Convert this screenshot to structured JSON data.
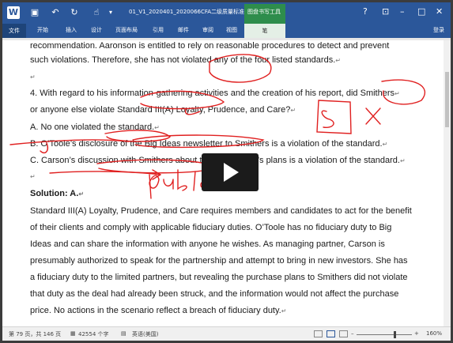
{
  "window": {
    "title": "01_V1_2020401_2020066CFA二级质量标准...",
    "contextual_tab": "图盘书写工具"
  },
  "ribbon": {
    "tabs": [
      "文件",
      "开始",
      "插入",
      "设计",
      "页面布局",
      "引用",
      "邮件",
      "审阅",
      "视图",
      "笔"
    ],
    "login": "登录"
  },
  "document": {
    "lines": [
      "recommendation. Aaronson is entitled to rely on reasonable procedures to detect and prevent",
      "such violations. Therefore, she has not violated any of the four listed standards.",
      "4.    With regard to his information-gathering activities and the creation of his report, did Smithers",
      "      or anyone else violate Standard III(A) Loyalty, Prudence, and Care?",
      "A.    No one violated the standard.",
      "B.    O’Toole’s disclosure of the Big Ideas newsletter to Smithers is a violation of the standard.",
      "C.    Carson’s discussion with Smithers about the partnership’s plans is a violation of the standard.",
      "Solution: A.",
      "Standard III(A) Loyalty, Prudence, and Care requires members and candidates to act for the benefit",
      "of their clients and comply with applicable fiduciary duties. O’Toole has no fiduciary duty to Big",
      "Ideas and can share the information with anyone he wishes. As managing partner, Carson is",
      "presumably authorized to speak for the partnership and attempt to bring in new investors. She has",
      "a fiduciary duty to the limited partners, but revealing the purchase plans to Smithers did not violate",
      "that duty as the deal had already been struck, and the information would not affect the purchase",
      "price. No actions in the scenario reflect a breach of fiduciary duty."
    ],
    "ink_notes": [
      "client",
      "S.",
      "X",
      "Public"
    ]
  },
  "statusbar": {
    "page": "第 79 页，共 146 页",
    "words": "42554 个字",
    "language": "英语(美国)",
    "zoom": "160%"
  }
}
